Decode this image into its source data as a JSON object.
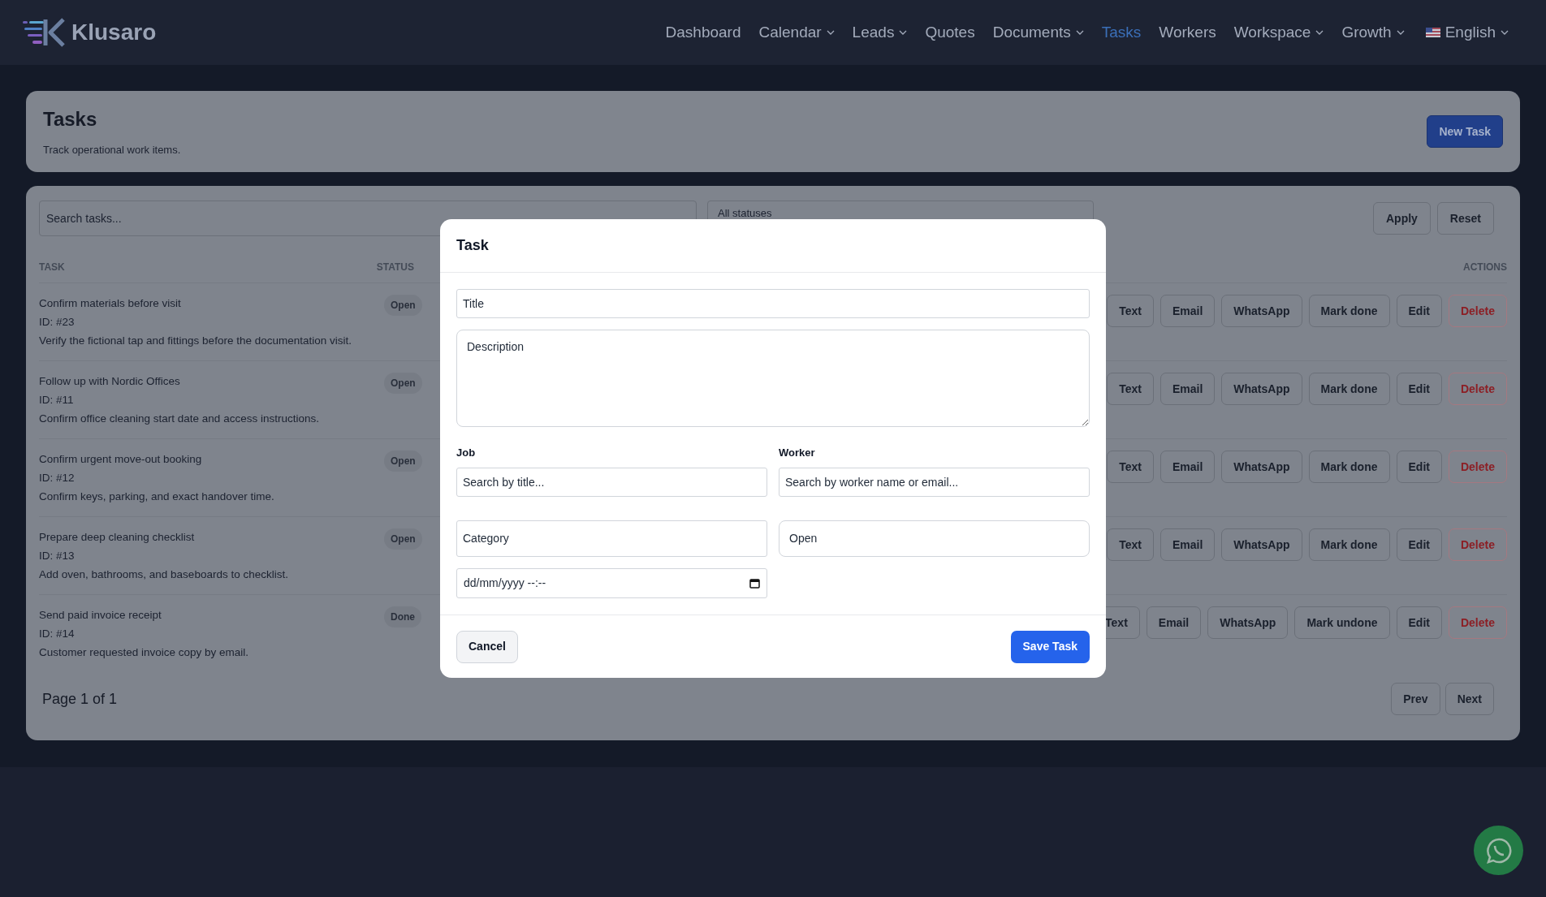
{
  "brand": {
    "name": "Klusaro"
  },
  "nav": [
    {
      "label": "Dashboard",
      "dropdown": false,
      "selected": false
    },
    {
      "label": "Calendar",
      "dropdown": true,
      "selected": false
    },
    {
      "label": "Leads",
      "dropdown": true,
      "selected": false
    },
    {
      "label": "Quotes",
      "dropdown": false,
      "selected": false
    },
    {
      "label": "Documents",
      "dropdown": true,
      "selected": false
    },
    {
      "label": "Tasks",
      "dropdown": false,
      "selected": true
    },
    {
      "label": "Workers",
      "dropdown": false,
      "selected": false
    },
    {
      "label": "Workspace",
      "dropdown": true,
      "selected": false
    },
    {
      "label": "Growth",
      "dropdown": true,
      "selected": false
    }
  ],
  "language": {
    "label": "English"
  },
  "page_header": {
    "title": "Tasks",
    "subtitle": "Track operational work items.",
    "button": "New Task"
  },
  "filters": {
    "search_placeholder": "Search tasks...",
    "status_select": "All statuses",
    "buttons": [
      "Apply",
      "Reset"
    ]
  },
  "table": {
    "columns": [
      "TASK",
      "STATUS",
      "ACTIONS"
    ],
    "rows": [
      {
        "title": "Confirm materials before visit",
        "id": "ID: #23",
        "description": "Verify the fictional tap and fittings before the documentation visit.",
        "status": "Open",
        "actions": [
          {
            "label": "Text",
            "kind": "normal"
          },
          {
            "label": "Email",
            "kind": "normal"
          },
          {
            "label": "WhatsApp",
            "kind": "normal"
          },
          {
            "label": "Mark done",
            "kind": "normal"
          },
          {
            "label": "Edit",
            "kind": "normal"
          },
          {
            "label": "Delete",
            "kind": "danger"
          }
        ]
      },
      {
        "title": "Follow up with Nordic Offices",
        "id": "ID: #11",
        "description": "Confirm office cleaning start date and access instructions.",
        "status": "Open",
        "actions": [
          {
            "label": "Text",
            "kind": "normal"
          },
          {
            "label": "Email",
            "kind": "normal"
          },
          {
            "label": "WhatsApp",
            "kind": "normal"
          },
          {
            "label": "Mark done",
            "kind": "normal"
          },
          {
            "label": "Edit",
            "kind": "normal"
          },
          {
            "label": "Delete",
            "kind": "danger"
          }
        ]
      },
      {
        "title": "Confirm urgent move-out booking",
        "id": "ID: #12",
        "description": "Confirm keys, parking, and exact handover time.",
        "status": "Open",
        "actions": [
          {
            "label": "Text",
            "kind": "normal"
          },
          {
            "label": "Email",
            "kind": "normal"
          },
          {
            "label": "WhatsApp",
            "kind": "normal"
          },
          {
            "label": "Mark done",
            "kind": "normal"
          },
          {
            "label": "Edit",
            "kind": "normal"
          },
          {
            "label": "Delete",
            "kind": "danger"
          }
        ]
      },
      {
        "title": "Prepare deep cleaning checklist",
        "id": "ID: #13",
        "description": "Add oven, bathrooms, and baseboards to checklist.",
        "status": "Open",
        "actions": [
          {
            "label": "Text",
            "kind": "normal"
          },
          {
            "label": "Email",
            "kind": "normal"
          },
          {
            "label": "WhatsApp",
            "kind": "normal"
          },
          {
            "label": "Mark done",
            "kind": "normal"
          },
          {
            "label": "Edit",
            "kind": "normal"
          },
          {
            "label": "Delete",
            "kind": "danger"
          }
        ]
      },
      {
        "title": "Send paid invoice receipt",
        "id": "ID: #14",
        "description": "Customer requested invoice copy by email.",
        "status": "Done",
        "actions": [
          {
            "label": "Text",
            "kind": "normal"
          },
          {
            "label": "Email",
            "kind": "normal"
          },
          {
            "label": "WhatsApp",
            "kind": "normal"
          },
          {
            "label": "Mark undone",
            "kind": "normal"
          },
          {
            "label": "Edit",
            "kind": "normal"
          },
          {
            "label": "Delete",
            "kind": "danger"
          }
        ]
      }
    ]
  },
  "pagination": {
    "label": "Page 1 of 1",
    "buttons": [
      "Prev",
      "Next"
    ]
  },
  "modal": {
    "title": "Task",
    "title_placeholder": "Title",
    "description_placeholder": "Description",
    "job": {
      "label": "Job",
      "placeholder": "Search by title..."
    },
    "worker": {
      "label": "Worker",
      "placeholder": "Search by worker name or email..."
    },
    "category_placeholder": "Category",
    "status_value": "Open",
    "due_value": "dd/mm/yyyy --:--",
    "cancel": "Cancel",
    "save": "Save Task"
  }
}
